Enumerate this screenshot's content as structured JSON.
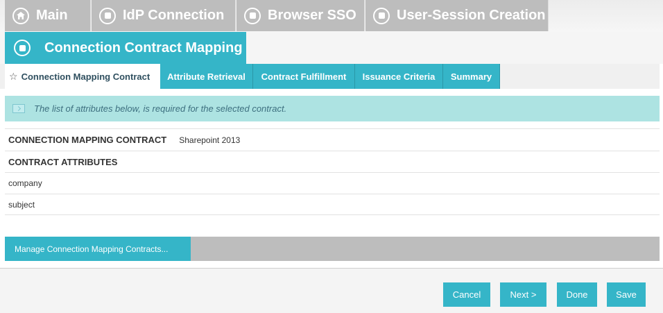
{
  "top_tabs": [
    {
      "label": "Main",
      "icon": "home-icon"
    },
    {
      "label": "IdP Connection",
      "icon": "circle-square-icon"
    },
    {
      "label": "Browser SSO",
      "icon": "circle-square-icon"
    },
    {
      "label": "User-Session Creation",
      "icon": "circle-square-icon"
    }
  ],
  "current_tab": {
    "label": "Connection Contract Mapping",
    "icon": "circle-square-icon"
  },
  "sub_tabs": [
    {
      "label": "Connection Mapping Contract",
      "active": true
    },
    {
      "label": "Attribute Retrieval"
    },
    {
      "label": "Contract Fulfillment"
    },
    {
      "label": "Issuance Criteria"
    },
    {
      "label": "Summary"
    }
  ],
  "info_banner": {
    "text": "The list of attributes below, is required for the selected contract."
  },
  "contract": {
    "label": "CONNECTION MAPPING CONTRACT",
    "value": "Sharepoint 2013"
  },
  "attributes": {
    "header": "CONTRACT ATTRIBUTES",
    "items": [
      "company",
      "subject"
    ]
  },
  "manage_button": "Manage Connection Mapping Contracts...",
  "footer": {
    "cancel": "Cancel",
    "next": "Next >",
    "done": "Done",
    "save": "Save"
  },
  "colors": {
    "accent": "#35b5c8",
    "inactive_tab": "#bdbdbd",
    "info_bg": "#ade3e2"
  }
}
